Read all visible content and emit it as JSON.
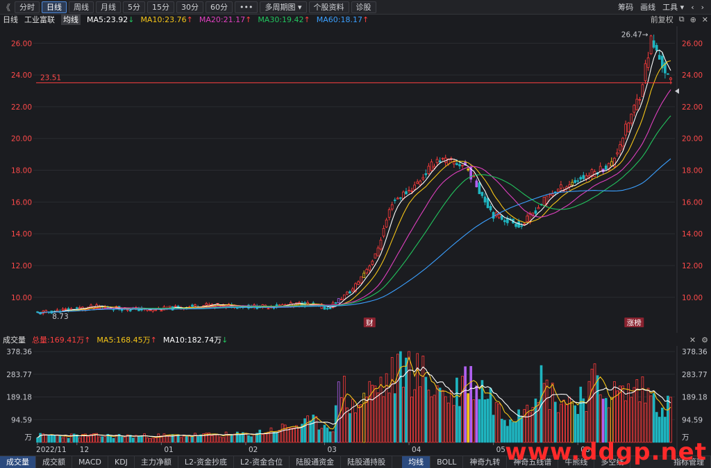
{
  "toolbar": {
    "back_icon": "《",
    "items": [
      {
        "label": "分时",
        "active": false
      },
      {
        "label": "日线",
        "active": true
      },
      {
        "label": "周线",
        "active": false
      },
      {
        "label": "月线",
        "active": false
      },
      {
        "label": "5分",
        "active": false
      },
      {
        "label": "15分",
        "active": false
      },
      {
        "label": "30分",
        "active": false
      },
      {
        "label": "60分",
        "active": false
      },
      {
        "label": "•••",
        "active": false
      },
      {
        "label": "多周期图 ▾",
        "active": false
      },
      {
        "label": "个股资料",
        "active": false
      },
      {
        "label": "诊股",
        "active": false
      }
    ],
    "right": [
      "筹码",
      "画线",
      "工具 ▾"
    ],
    "right_icons": [
      "‹",
      "›"
    ]
  },
  "legend": {
    "period": "日线",
    "stock_name": "工业富联",
    "avg_label": "均线",
    "ma": [
      {
        "label": "MA5:23.92",
        "color": "#ffffff",
        "dir": "down"
      },
      {
        "label": "MA10:23.76",
        "color": "#f5c518",
        "dir": "up"
      },
      {
        "label": "MA20:21.17",
        "color": "#e040c0",
        "dir": "up"
      },
      {
        "label": "MA30:19.42",
        "color": "#22c55e",
        "dir": "up"
      },
      {
        "label": "MA60:18.17",
        "color": "#3ba0ff",
        "dir": "up"
      }
    ],
    "adjust": "前复权",
    "icons": [
      "⧉",
      "⊕",
      "✕"
    ]
  },
  "volume_legend": {
    "title": "成交量",
    "total": "总量:169.41万",
    "ma5": "MA5:168.45万",
    "ma10": "MA10:182.74万",
    "icons": [
      "✕",
      "⚙"
    ]
  },
  "bottom_tabs": [
    "成交量",
    "成交额",
    "MACD",
    "KDJ",
    "主力净额",
    "L2-资金抄底",
    "L2-资金合位",
    "陆股通资金",
    "陆股通持股",
    "均线",
    "BOLL",
    "神奇九转",
    "神奇五线谱",
    "牛熊线",
    "多空线"
  ],
  "bottom_right": "指标管理",
  "watermark": "www.ddgp.net",
  "colors": {
    "up": "#ff3b3b",
    "down": "#1fb5c0",
    "purple": "#b060f0",
    "yellow": "#f5c518",
    "ref_line": "#ff4040"
  },
  "chart_data": [
    {
      "type": "candlestick",
      "ylim": [
        8.2,
        26.8
      ],
      "yticks": [
        10.0,
        12.0,
        14.0,
        16.0,
        18.0,
        20.0,
        22.0,
        24.0,
        26.0
      ],
      "ytick_labels": [
        "10.00",
        "12.00",
        "14.00",
        "16.00",
        "18.00",
        "20.00",
        "22.00",
        "24.00",
        "26.00"
      ],
      "x_labels": [
        "2022/11",
        "12",
        "01",
        "02",
        "03",
        "04",
        "05",
        "06"
      ],
      "x_label_index": [
        0,
        14,
        44,
        74,
        102,
        132,
        162,
        192
      ],
      "ref_value": 23.51,
      "ref_label": "23.51",
      "annotations": [
        {
          "text": "26.47→",
          "value": 26.47,
          "index": 218
        },
        {
          "text": "8.73",
          "value": 8.73,
          "index": 12
        }
      ],
      "markers": [
        {
          "text": "财",
          "index": 118
        },
        {
          "text": "涨榜",
          "index": 212
        }
      ],
      "key_points": [
        [
          0,
          9.0
        ],
        [
          20,
          9.4
        ],
        [
          40,
          9.2
        ],
        [
          60,
          9.5
        ],
        [
          80,
          9.4
        ],
        [
          95,
          9.6
        ],
        [
          103,
          9.3
        ],
        [
          112,
          10.5
        ],
        [
          120,
          12.6
        ],
        [
          126,
          16.0
        ],
        [
          134,
          17.0
        ],
        [
          142,
          18.7
        ],
        [
          152,
          18.3
        ],
        [
          162,
          15.2
        ],
        [
          172,
          14.5
        ],
        [
          182,
          16.5
        ],
        [
          192,
          17.4
        ],
        [
          204,
          18.4
        ],
        [
          214,
          22.8
        ],
        [
          218,
          26.2
        ],
        [
          221,
          25.0
        ],
        [
          225,
          23.51
        ]
      ],
      "ma_last": {
        "MA5": 23.92,
        "MA10": 23.76,
        "MA20": 21.17,
        "MA30": 19.42,
        "MA60": 18.17
      }
    },
    {
      "type": "bar",
      "title": "成交量",
      "unit": "万",
      "ylim": [
        0,
        378.36
      ],
      "yticks": [
        94.59,
        189.18,
        283.77,
        378.36
      ],
      "ytick_labels": [
        "94.59",
        "189.18",
        "283.77",
        "378.36"
      ],
      "key_points": [
        [
          0,
          30
        ],
        [
          40,
          28
        ],
        [
          75,
          35
        ],
        [
          98,
          90
        ],
        [
          105,
          70
        ],
        [
          108,
          270
        ],
        [
          112,
          150
        ],
        [
          118,
          230
        ],
        [
          125,
          270
        ],
        [
          130,
          360
        ],
        [
          136,
          300
        ],
        [
          142,
          240
        ],
        [
          148,
          200
        ],
        [
          152,
          300
        ],
        [
          160,
          220
        ],
        [
          166,
          110
        ],
        [
          172,
          160
        ],
        [
          178,
          280
        ],
        [
          184,
          200
        ],
        [
          190,
          180
        ],
        [
          198,
          260
        ],
        [
          206,
          210
        ],
        [
          214,
          240
        ],
        [
          220,
          190
        ],
        [
          224,
          170
        ]
      ],
      "last": {
        "total": 169.41,
        "MA5": 168.45,
        "MA10": 182.74
      }
    }
  ]
}
